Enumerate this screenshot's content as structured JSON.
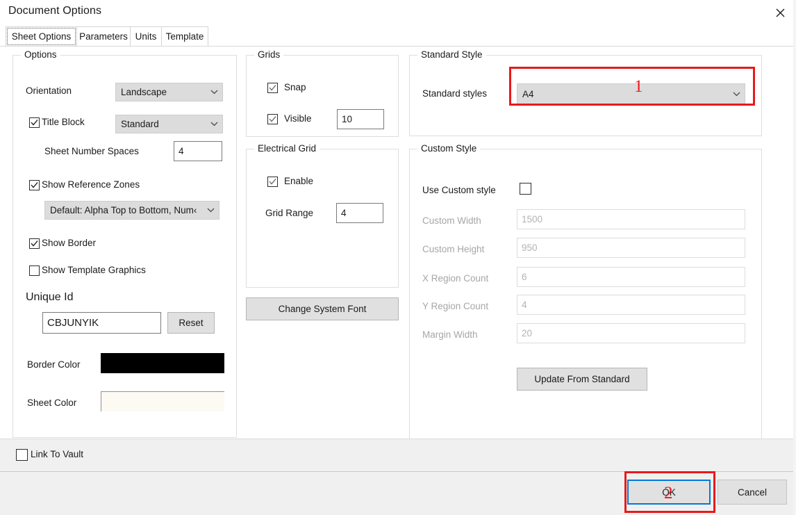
{
  "window": {
    "title": "Document Options",
    "close_icon": "close-icon"
  },
  "tabs": [
    {
      "label": "Sheet Options",
      "active": true
    },
    {
      "label": "Parameters",
      "active": false
    },
    {
      "label": "Units",
      "active": false
    },
    {
      "label": "Template",
      "active": false
    }
  ],
  "options_group": {
    "legend": "Options",
    "orientation_label": "Orientation",
    "orientation_value": "Landscape",
    "title_block_label": "Title Block",
    "title_block_checked": true,
    "title_block_value": "Standard",
    "sheet_number_spaces_label": "Sheet Number Spaces",
    "sheet_number_spaces_value": "4",
    "show_reference_zones_label": "Show Reference Zones",
    "show_reference_zones_checked": true,
    "reference_zones_value": "Default: Alpha Top to Bottom, Num‹",
    "show_border_label": "Show Border",
    "show_border_checked": true,
    "show_template_graphics_label": "Show Template Graphics",
    "show_template_graphics_checked": false,
    "unique_id_label": "Unique Id",
    "unique_id_value": "CBJUNYIK",
    "reset_label": "Reset",
    "border_color_label": "Border Color",
    "border_color_value": "#000000",
    "sheet_color_label": "Sheet Color",
    "sheet_color_value": "#fdfaf4"
  },
  "grids_group": {
    "legend": "Grids",
    "snap_label": "Snap",
    "snap_checked": true,
    "visible_label": "Visible",
    "visible_checked": true,
    "visible_value": "10"
  },
  "electrical_grid_group": {
    "legend": "Electrical Grid",
    "enable_label": "Enable",
    "enable_checked": true,
    "grid_range_label": "Grid Range",
    "grid_range_value": "4"
  },
  "change_system_font_label": "Change System Font",
  "standard_style_group": {
    "legend": "Standard Style",
    "standard_styles_label": "Standard styles",
    "standard_styles_value": "A4"
  },
  "custom_style_group": {
    "legend": "Custom Style",
    "use_custom_style_label": "Use Custom style",
    "use_custom_style_checked": false,
    "fields": [
      {
        "label": "Custom Width",
        "value": "1500"
      },
      {
        "label": "Custom Height",
        "value": "950"
      },
      {
        "label": "X Region Count",
        "value": "6"
      },
      {
        "label": "Y Region Count",
        "value": "4"
      },
      {
        "label": "Margin Width",
        "value": "20"
      }
    ],
    "update_from_standard_label": "Update From Standard"
  },
  "footer": {
    "link_to_vault_label": "Link To Vault",
    "link_to_vault_checked": false,
    "ok_label": "OK",
    "cancel_label": "Cancel"
  },
  "annotations": {
    "marker_1": "1",
    "marker_2": "2",
    "color": "#e8191b"
  }
}
